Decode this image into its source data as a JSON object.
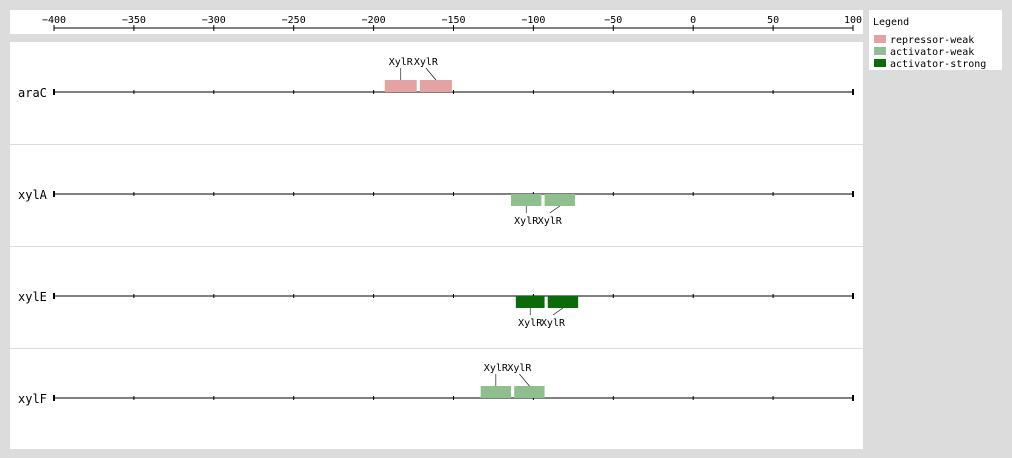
{
  "axis": {
    "ticks": [
      -400,
      -350,
      -300,
      -250,
      -200,
      -150,
      -100,
      -50,
      0,
      50,
      100
    ],
    "range": [
      -400,
      100
    ]
  },
  "legend": {
    "title": "Legend",
    "items": [
      {
        "label": "repressor-weak",
        "color": "#e4a3a3"
      },
      {
        "label": "activator-weak",
        "color": "#8fbf8f"
      },
      {
        "label": "activator-strong",
        "color": "#0b6b0b"
      }
    ]
  },
  "tracks": [
    {
      "gene": "araC",
      "label_side": "above",
      "sites": [
        {
          "label": "XylR",
          "type": "repressor-weak",
          "start": -193,
          "end": -173
        },
        {
          "label": "XylR",
          "type": "repressor-weak",
          "start": -171,
          "end": -151
        }
      ]
    },
    {
      "gene": "xylA",
      "label_side": "below",
      "sites": [
        {
          "label": "XylR",
          "type": "activator-weak",
          "start": -114,
          "end": -95
        },
        {
          "label": "XylR",
          "type": "activator-weak",
          "start": -93,
          "end": -74
        }
      ]
    },
    {
      "gene": "xylE",
      "label_side": "below",
      "sites": [
        {
          "label": "XylR",
          "type": "activator-strong",
          "start": -111,
          "end": -93
        },
        {
          "label": "XylR",
          "type": "activator-strong",
          "start": -91,
          "end": -72
        }
      ]
    },
    {
      "gene": "xylF",
      "label_side": "above",
      "sites": [
        {
          "label": "XylR",
          "type": "activator-weak",
          "start": -133,
          "end": -114
        },
        {
          "label": "XylR",
          "type": "activator-weak",
          "start": -112,
          "end": -93
        }
      ]
    }
  ]
}
